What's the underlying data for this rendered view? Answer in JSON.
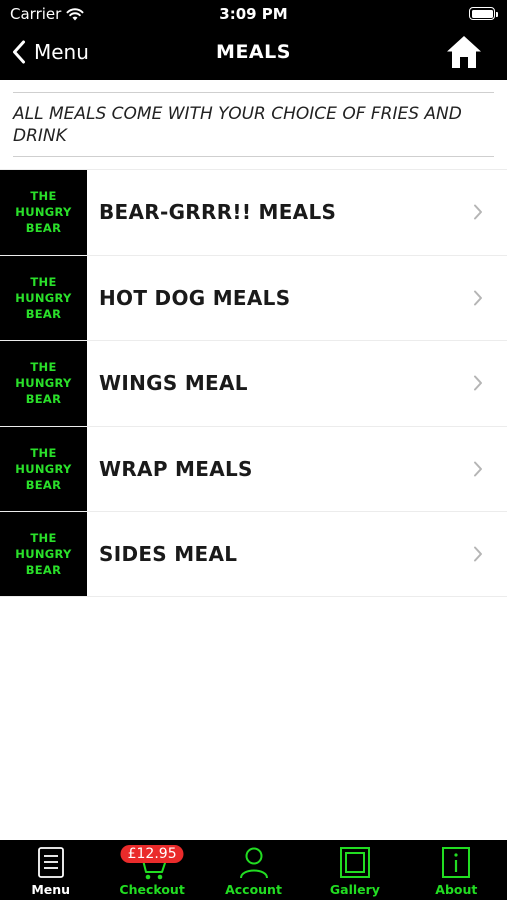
{
  "status": {
    "carrier": "Carrier",
    "time": "3:09 PM"
  },
  "nav": {
    "back_label": "Menu",
    "title": "MEALS"
  },
  "notice": "ALL MEALS COME WITH YOUR CHOICE OF FRIES AND DRINK",
  "thumb_logo": [
    "THE",
    "HUNGRY",
    "BEAR"
  ],
  "items": [
    {
      "label": "BEAR-GRRR!! MEALS"
    },
    {
      "label": "HOT DOG MEALS"
    },
    {
      "label": "WINGS MEAL"
    },
    {
      "label": "WRAP MEALS"
    },
    {
      "label": "SIDES MEAL"
    }
  ],
  "tabs": [
    {
      "label": "Menu",
      "icon": "menu-list-icon"
    },
    {
      "label": "Checkout",
      "icon": "cart-icon",
      "badge": "£12.95"
    },
    {
      "label": "Account",
      "icon": "person-icon"
    },
    {
      "label": "Gallery",
      "icon": "gallery-icon"
    },
    {
      "label": "About",
      "icon": "info-icon"
    }
  ],
  "colors": {
    "accent": "#22dd22",
    "bar": "#000000",
    "badge": "#ea2b2b"
  }
}
